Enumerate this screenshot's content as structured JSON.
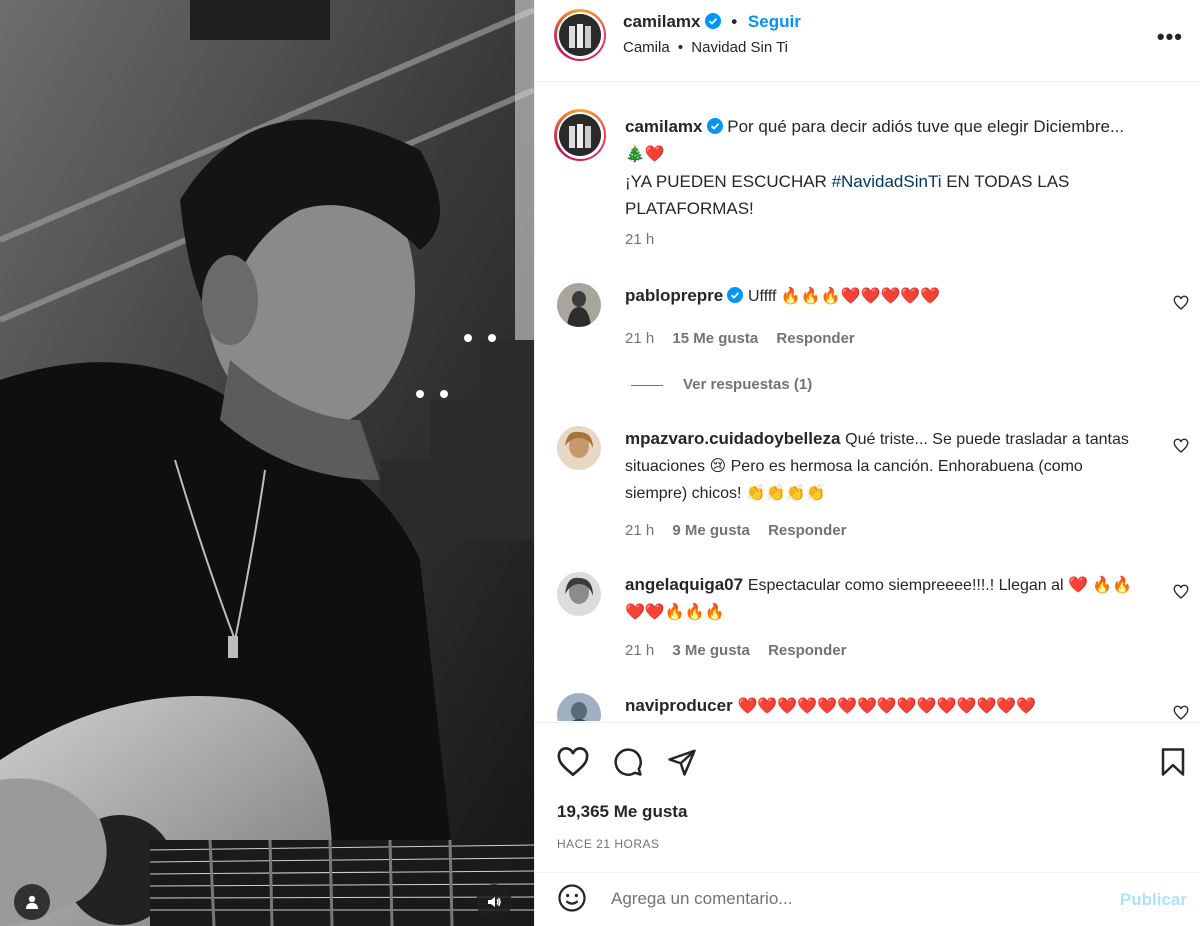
{
  "post": {
    "username": "camilamx",
    "follow_label": "Seguir",
    "separator": "•",
    "subtitle_artist": "Camila",
    "subtitle_song": "Navidad Sin Ti",
    "more_label": "•••"
  },
  "caption": {
    "username": "camilamx",
    "text_line1": "Por qué para decir adiós tuve que elegir Diciembre...",
    "emojis_line2": "🎄❤️",
    "text_line3_prefix": "¡YA PUEDEN ESCUCHAR ",
    "hashtag": "#NavidadSinTi",
    "text_line3_suffix": " EN TODAS LAS PLATAFORMAS!",
    "time": "21 h"
  },
  "comments": [
    {
      "username": "pabloprepre",
      "verified": true,
      "text": "Uffff 🔥🔥🔥❤️❤️❤️❤️❤️",
      "time": "21 h",
      "likes": "15 Me gusta",
      "reply": "Responder",
      "view_replies": "Ver respuestas (1)"
    },
    {
      "username": "mpazvaro.cuidadoybelleza",
      "verified": false,
      "text": "Qué triste... Se puede trasladar a tantas situaciones 😢 Pero es hermosa la canción. Enhorabuena (como siempre) chicos! 👏👏👏👏",
      "time": "21 h",
      "likes": "9 Me gusta",
      "reply": "Responder"
    },
    {
      "username": "angelaquiga07",
      "verified": false,
      "text": "Espectacular como siempreeee!!!.! Llegan al ❤️ 🔥🔥❤️❤️🔥🔥🔥",
      "time": "21 h",
      "likes": "3 Me gusta",
      "reply": "Responder"
    },
    {
      "username": "naviproducer",
      "verified": false,
      "text": "❤️❤️❤️❤️❤️❤️❤️❤️❤️❤️❤️❤️❤️❤️❤️"
    }
  ],
  "actions": {
    "like_icon": "heart-icon",
    "comment_icon": "comment-icon",
    "share_icon": "share-icon",
    "save_icon": "bookmark-icon"
  },
  "likes_count": "19,365 Me gusta",
  "posted_when": "HACE 21 HORAS",
  "add_comment": {
    "placeholder": "Agrega un comentario...",
    "publish_label": "Publicar"
  },
  "colors": {
    "link_blue": "#0095f6",
    "hashtag_blue": "#00376b",
    "muted": "#737373",
    "publish_disabled": "#b2dffc"
  }
}
